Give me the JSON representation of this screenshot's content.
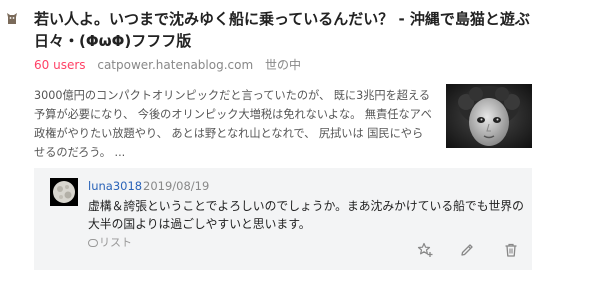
{
  "entry": {
    "title": "若い人よ。いつまで沈みゆく船に乗っているんだい？ - 沖縄で島猫と遊ぶ日々・(ΦωΦ)フフフ版",
    "users": "60 users",
    "domain": "catpower.hatenablog.com",
    "category": "世の中",
    "excerpt": "3000億円のコンパクトオリンピックだと言っていたのが、 既に3兆円を超える予算が必要になり、 今後のオリンピック大増税は免れないよな。 無責任なアベ政権がやりたい放題やり、 あとは野となれ山となれで、 尻拭いは 国民にやらせるのだろう。 ...",
    "favicon_icon": "cat-favicon-icon",
    "thumbnail": "child-portrait-thumbnail"
  },
  "comment": {
    "avatar_icon": "moon-avatar-icon",
    "user": "luna3018",
    "date": "2019/08/19",
    "text": "虚構＆誇張ということでよろしいのでしょうか。まあ沈みかけている船でも世界の大半の国よりは過ごしやすいと思います。",
    "list_label": "リスト",
    "actions": [
      "add-star-icon",
      "edit-icon",
      "delete-icon"
    ]
  },
  "colors": {
    "users": "#ff4166",
    "username": "#2a63b8",
    "comment_bg": "#f3f4f5"
  }
}
